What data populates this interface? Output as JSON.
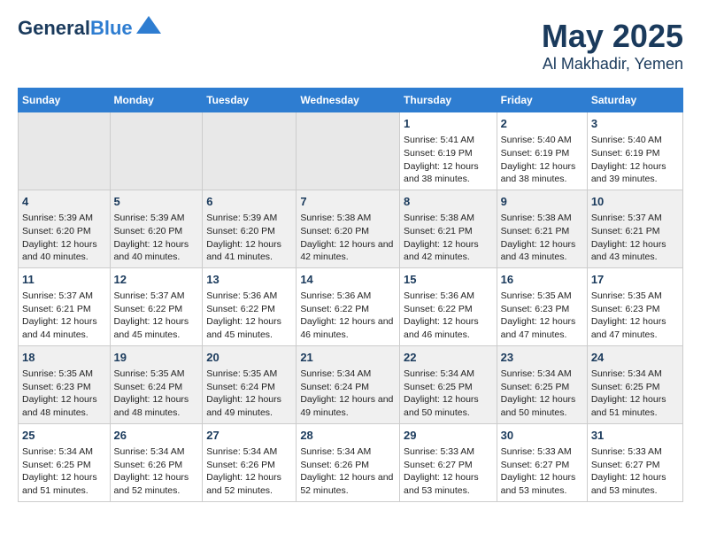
{
  "header": {
    "logo_line1": "General",
    "logo_line2": "Blue",
    "title": "May 2025",
    "subtitle": "Al Makhadir, Yemen"
  },
  "days_of_week": [
    "Sunday",
    "Monday",
    "Tuesday",
    "Wednesday",
    "Thursday",
    "Friday",
    "Saturday"
  ],
  "weeks": [
    [
      {
        "day": "",
        "empty": true
      },
      {
        "day": "",
        "empty": true
      },
      {
        "day": "",
        "empty": true
      },
      {
        "day": "",
        "empty": true
      },
      {
        "day": "1",
        "sunrise": "5:41 AM",
        "sunset": "6:19 PM",
        "daylight": "12 hours and 38 minutes."
      },
      {
        "day": "2",
        "sunrise": "5:40 AM",
        "sunset": "6:19 PM",
        "daylight": "12 hours and 38 minutes."
      },
      {
        "day": "3",
        "sunrise": "5:40 AM",
        "sunset": "6:19 PM",
        "daylight": "12 hours and 39 minutes."
      }
    ],
    [
      {
        "day": "4",
        "sunrise": "5:39 AM",
        "sunset": "6:20 PM",
        "daylight": "12 hours and 40 minutes."
      },
      {
        "day": "5",
        "sunrise": "5:39 AM",
        "sunset": "6:20 PM",
        "daylight": "12 hours and 40 minutes."
      },
      {
        "day": "6",
        "sunrise": "5:39 AM",
        "sunset": "6:20 PM",
        "daylight": "12 hours and 41 minutes."
      },
      {
        "day": "7",
        "sunrise": "5:38 AM",
        "sunset": "6:20 PM",
        "daylight": "12 hours and 42 minutes."
      },
      {
        "day": "8",
        "sunrise": "5:38 AM",
        "sunset": "6:21 PM",
        "daylight": "12 hours and 42 minutes."
      },
      {
        "day": "9",
        "sunrise": "5:38 AM",
        "sunset": "6:21 PM",
        "daylight": "12 hours and 43 minutes."
      },
      {
        "day": "10",
        "sunrise": "5:37 AM",
        "sunset": "6:21 PM",
        "daylight": "12 hours and 43 minutes."
      }
    ],
    [
      {
        "day": "11",
        "sunrise": "5:37 AM",
        "sunset": "6:21 PM",
        "daylight": "12 hours and 44 minutes."
      },
      {
        "day": "12",
        "sunrise": "5:37 AM",
        "sunset": "6:22 PM",
        "daylight": "12 hours and 45 minutes."
      },
      {
        "day": "13",
        "sunrise": "5:36 AM",
        "sunset": "6:22 PM",
        "daylight": "12 hours and 45 minutes."
      },
      {
        "day": "14",
        "sunrise": "5:36 AM",
        "sunset": "6:22 PM",
        "daylight": "12 hours and 46 minutes."
      },
      {
        "day": "15",
        "sunrise": "5:36 AM",
        "sunset": "6:22 PM",
        "daylight": "12 hours and 46 minutes."
      },
      {
        "day": "16",
        "sunrise": "5:35 AM",
        "sunset": "6:23 PM",
        "daylight": "12 hours and 47 minutes."
      },
      {
        "day": "17",
        "sunrise": "5:35 AM",
        "sunset": "6:23 PM",
        "daylight": "12 hours and 47 minutes."
      }
    ],
    [
      {
        "day": "18",
        "sunrise": "5:35 AM",
        "sunset": "6:23 PM",
        "daylight": "12 hours and 48 minutes."
      },
      {
        "day": "19",
        "sunrise": "5:35 AM",
        "sunset": "6:24 PM",
        "daylight": "12 hours and 48 minutes."
      },
      {
        "day": "20",
        "sunrise": "5:35 AM",
        "sunset": "6:24 PM",
        "daylight": "12 hours and 49 minutes."
      },
      {
        "day": "21",
        "sunrise": "5:34 AM",
        "sunset": "6:24 PM",
        "daylight": "12 hours and 49 minutes."
      },
      {
        "day": "22",
        "sunrise": "5:34 AM",
        "sunset": "6:25 PM",
        "daylight": "12 hours and 50 minutes."
      },
      {
        "day": "23",
        "sunrise": "5:34 AM",
        "sunset": "6:25 PM",
        "daylight": "12 hours and 50 minutes."
      },
      {
        "day": "24",
        "sunrise": "5:34 AM",
        "sunset": "6:25 PM",
        "daylight": "12 hours and 51 minutes."
      }
    ],
    [
      {
        "day": "25",
        "sunrise": "5:34 AM",
        "sunset": "6:25 PM",
        "daylight": "12 hours and 51 minutes."
      },
      {
        "day": "26",
        "sunrise": "5:34 AM",
        "sunset": "6:26 PM",
        "daylight": "12 hours and 52 minutes."
      },
      {
        "day": "27",
        "sunrise": "5:34 AM",
        "sunset": "6:26 PM",
        "daylight": "12 hours and 52 minutes."
      },
      {
        "day": "28",
        "sunrise": "5:34 AM",
        "sunset": "6:26 PM",
        "daylight": "12 hours and 52 minutes."
      },
      {
        "day": "29",
        "sunrise": "5:33 AM",
        "sunset": "6:27 PM",
        "daylight": "12 hours and 53 minutes."
      },
      {
        "day": "30",
        "sunrise": "5:33 AM",
        "sunset": "6:27 PM",
        "daylight": "12 hours and 53 minutes."
      },
      {
        "day": "31",
        "sunrise": "5:33 AM",
        "sunset": "6:27 PM",
        "daylight": "12 hours and 53 minutes."
      }
    ]
  ]
}
